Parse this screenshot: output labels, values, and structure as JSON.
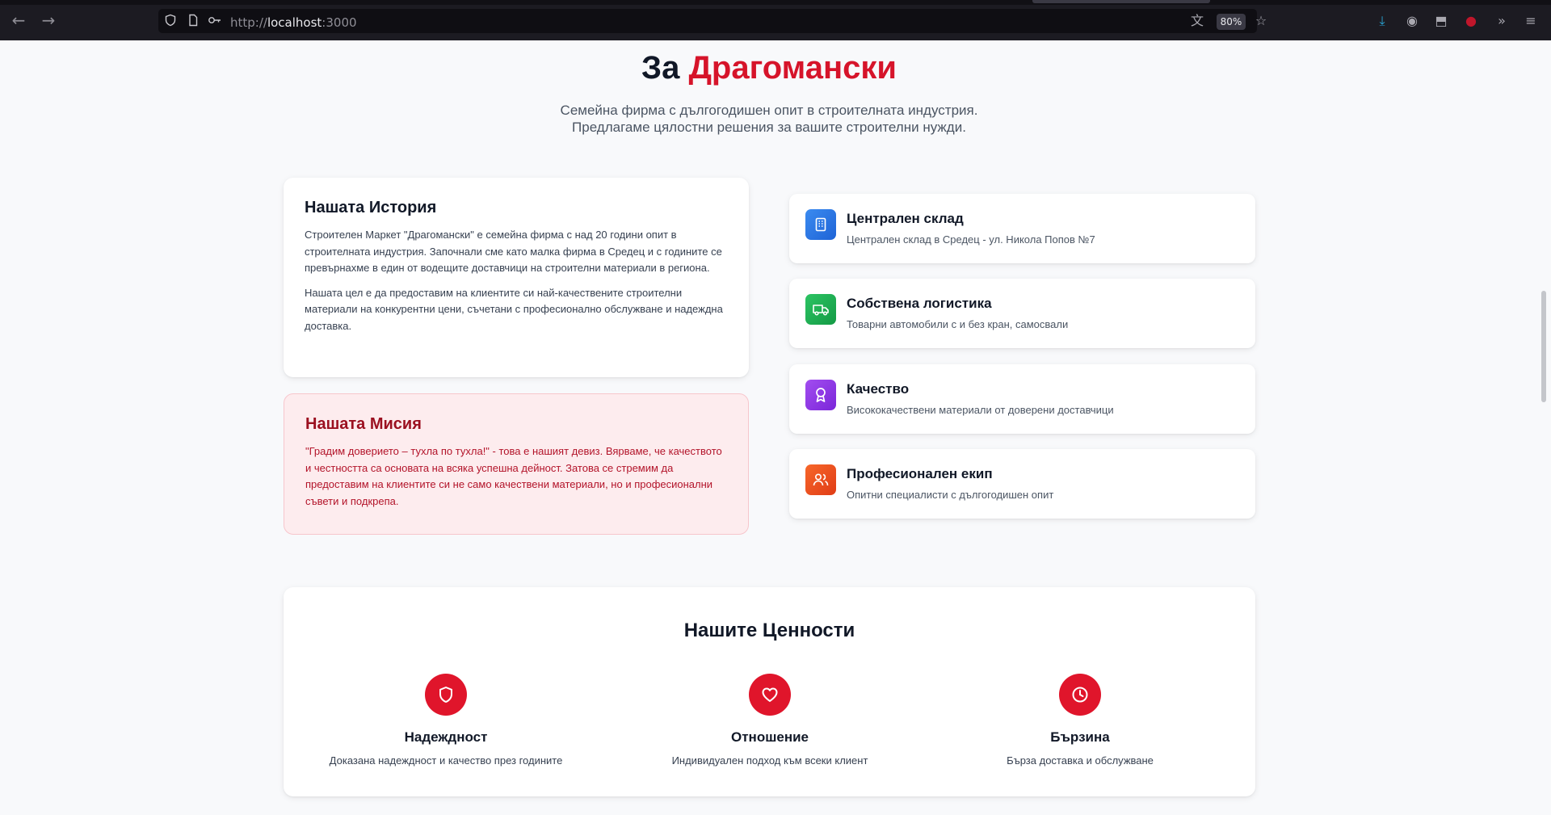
{
  "browser": {
    "url_prefix": "http://",
    "url_host": "localhost",
    "url_port": ":3000",
    "zoom": "80%",
    "icons": [
      "back-arrow-icon",
      "forward-arrow-icon",
      "shield-icon",
      "page-icon",
      "key-icon",
      "translate-icon",
      "star-icon",
      "download-icon",
      "profile-icon",
      "extensions-icon",
      "addon-icon",
      "overflow-icon",
      "menu-icon"
    ]
  },
  "hero": {
    "title_prefix": "За ",
    "title_accent": "Драгомански",
    "subtitle_line1": "Семейна фирма с дългогодишен опит в строителната индустрия.",
    "subtitle_line2": "Предлагаме цялостни решения за вашите строителни нужди."
  },
  "story": {
    "title": "Нашата История",
    "p1": "Строителен Маркет \"Драгомански\" е семейна фирма с над 20 години опит в строителната индустрия. Започнали сме като малка фирма в Средец и с годините се превърнахме в един от водещите доставчици на строителни материали в региона.",
    "p2": "Нашата цел е да предоставим на клиентите си най-качествените строителни материали на конкурентни цени, съчетани с професионално обслужване и надеждна доставка."
  },
  "mission": {
    "title": "Нашата Мисия",
    "text": "\"Градим доверието – тухла по тухла!\" - това е нашият девиз. Вярваме, че качеството и честността са основата на всяка успешна дейност. Затова се стремим да предоставим на клиентите си не само качествени материали, но и професионални съвети и подкрепа."
  },
  "features": [
    {
      "title": "Централен склад",
      "desc": "Централен склад в Средец - ул. Никола Попов №7",
      "icon": "building-icon",
      "color": "#2f7be6"
    },
    {
      "title": "Собствена логистика",
      "desc": "Товарни автомобили с и без кран, самосвали",
      "icon": "truck-icon",
      "color": "#1fb154"
    },
    {
      "title": "Качество",
      "desc": "Висококачествени материали от доверени доставчици",
      "icon": "award-icon",
      "color": "#9333ea"
    },
    {
      "title": "Професионален екип",
      "desc": "Опитни специалисти с дългогодишен опит",
      "icon": "users-icon",
      "color": "#f0511f"
    }
  ],
  "values": {
    "title": "Нашите Ценности",
    "items": [
      {
        "title": "Надеждност",
        "desc": "Доказана надеждност и качество през годините",
        "icon": "shield-icon"
      },
      {
        "title": "Отношение",
        "desc": "Индивидуален подход към всеки клиент",
        "icon": "heart-icon"
      },
      {
        "title": "Бързина",
        "desc": "Бърза доставка и обслужване",
        "icon": "clock-icon"
      }
    ],
    "accent": "#e0152b"
  }
}
